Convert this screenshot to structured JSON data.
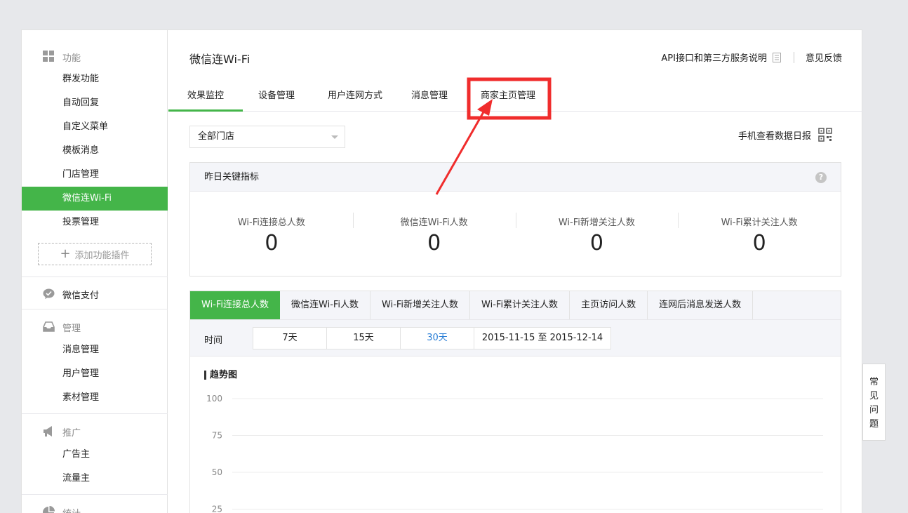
{
  "sidebar": {
    "sections": [
      {
        "title": "功能",
        "icon": "grid-icon",
        "items": [
          "群发功能",
          "自动回复",
          "自定义菜单",
          "模板消息",
          "门店管理",
          "微信连Wi-Fi",
          "投票管理"
        ]
      },
      {
        "title": "微信支付",
        "icon": "wechat-pay-icon",
        "items": []
      },
      {
        "title": "管理",
        "icon": "inbox-icon",
        "items": [
          "消息管理",
          "用户管理",
          "素材管理"
        ]
      },
      {
        "title": "推广",
        "icon": "megaphone-icon",
        "items": [
          "广告主",
          "流量主"
        ]
      },
      {
        "title": "统计",
        "icon": "pie-chart-icon",
        "items": []
      }
    ],
    "active_item": "微信连Wi-Fi",
    "add_plugin": "添加功能插件"
  },
  "header": {
    "title": "微信连Wi-Fi",
    "api_link": "API接口和第三方服务说明",
    "feedback": "意见反馈"
  },
  "tabs": [
    "效果监控",
    "设备管理",
    "用户连网方式",
    "消息管理",
    "商家主页管理"
  ],
  "active_tab": "效果监控",
  "store_select": {
    "value": "全部门店"
  },
  "mobile_report": "手机查看数据日报",
  "kpi": {
    "title": "昨日关键指标",
    "items": [
      {
        "name": "Wi-Fi连接总人数",
        "value": "0"
      },
      {
        "name": "微信连Wi-Fi人数",
        "value": "0"
      },
      {
        "name": "Wi-Fi新增关注人数",
        "value": "0"
      },
      {
        "name": "Wi-Fi累计关注人数",
        "value": "0"
      }
    ]
  },
  "metric_tabs": [
    "Wi-Fi连接总人数",
    "微信连Wi-Fi人数",
    "Wi-Fi新增关注人数",
    "Wi-Fi累计关注人数",
    "主页访问人数",
    "连网后消息发送人数"
  ],
  "active_metric": "Wi-Fi连接总人数",
  "time_filter": {
    "label": "时间",
    "options": [
      "7天",
      "15天",
      "30天"
    ],
    "selected": "30天",
    "date_range": "2015-11-15 至 2015-12-14"
  },
  "chart_data": {
    "type": "line",
    "title": "趋势图",
    "y_ticks": [
      100,
      75,
      50,
      25
    ],
    "ylim": [
      0,
      100
    ],
    "series": [],
    "grid": true
  },
  "faq": "常见问题",
  "colors": {
    "accent": "#44b549",
    "annotation": "#f02c2c",
    "link": "#2a7ed6"
  }
}
